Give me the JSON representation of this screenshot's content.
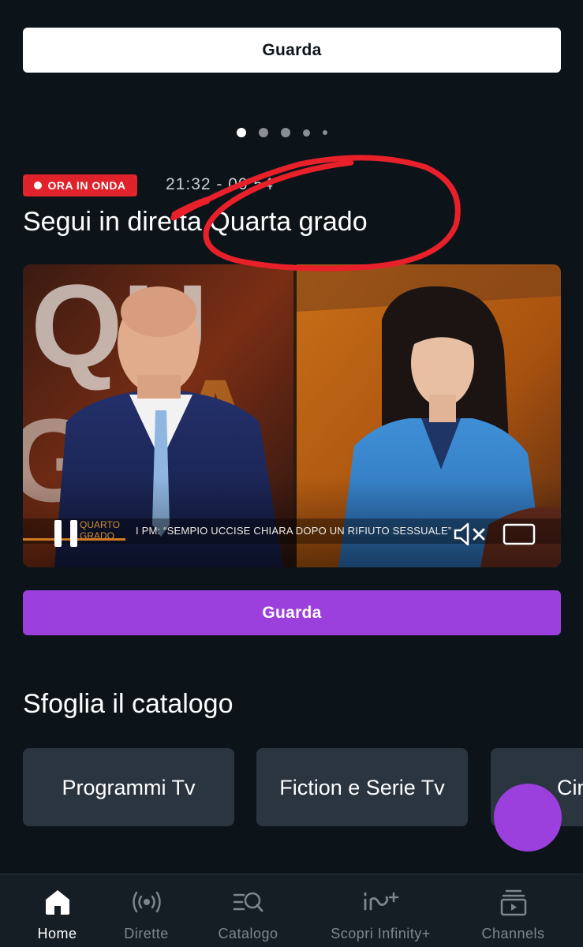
{
  "hero": {
    "watch_label": "Guarda"
  },
  "carousel": {
    "dots": 5,
    "active_index": 0
  },
  "live": {
    "badge": "ORA IN ONDA",
    "time_range": "21:32 - 00:54",
    "title": "Segui in diretta Quarta grado",
    "ticker": "I PM: “SEMPIO UCCISE CHIARA DOPO UN RIFIUTO SESSUALE”",
    "watch_label": "Guarda"
  },
  "catalog": {
    "title": "Sfoglia il catalogo",
    "items": [
      {
        "label": "Programmi Tv"
      },
      {
        "label": "Fiction e Serie Tv"
      },
      {
        "label": "Cinema"
      }
    ]
  },
  "bottom_nav": {
    "items": [
      {
        "label": "Home",
        "icon": "home-icon",
        "active": true
      },
      {
        "label": "Dirette",
        "icon": "live-broadcast-icon",
        "active": false
      },
      {
        "label": "Catalogo",
        "icon": "catalog-search-icon",
        "active": false
      },
      {
        "label": "Scopri Infinity+",
        "icon": "infinity-plus-icon",
        "active": false
      },
      {
        "label": "Channels",
        "icon": "channels-icon",
        "active": false
      }
    ]
  },
  "colors": {
    "background": "#0d1419",
    "accent_purple": "#9b40dc",
    "live_red": "#e0222b",
    "card": "#2b3540",
    "annotation_red": "#e8202a"
  }
}
